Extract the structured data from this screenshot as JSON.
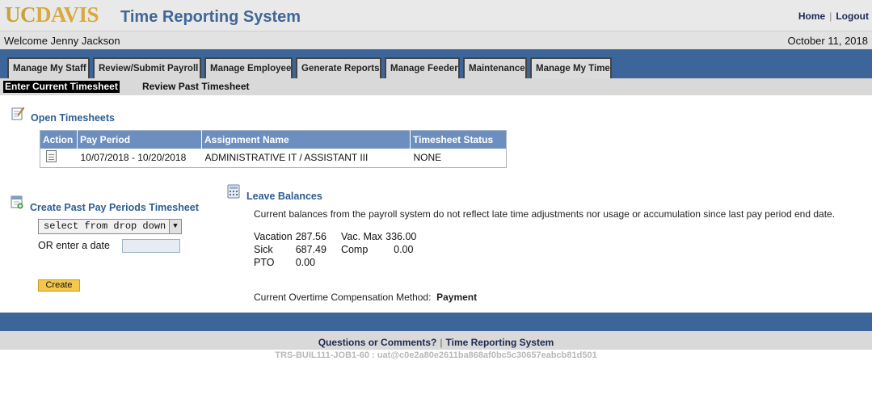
{
  "header": {
    "logo_uc": "UC",
    "logo_davis": "DAVIS",
    "title": "Time Reporting System",
    "home_label": "Home",
    "logout_label": "Logout",
    "separator": "|"
  },
  "welcome": {
    "text": "Welcome Jenny Jackson",
    "date": "October 11, 2018"
  },
  "tabs": [
    {
      "label": "Manage My Staff"
    },
    {
      "label": "Review/Submit Payroll"
    },
    {
      "label": "Manage Employee"
    },
    {
      "label": "Generate Reports"
    },
    {
      "label": "Manage Feeder"
    },
    {
      "label": "Maintenance"
    },
    {
      "label": "Manage My Time",
      "active": true
    }
  ],
  "subnav": {
    "active": "Enter Current Timesheet",
    "other": "Review Past Timesheet"
  },
  "open_timesheets": {
    "title": "Open Timesheets",
    "icon": "edit-note-icon",
    "columns": [
      "Action",
      "Pay Period",
      "Assignment Name",
      "Timesheet Status"
    ],
    "rows": [
      {
        "action_icon": "document-icon",
        "pay_period": "10/07/2018 - 10/20/2018",
        "assignment": "ADMINISTRATIVE IT / ASSISTANT III",
        "status": "NONE"
      }
    ]
  },
  "past_periods": {
    "title": "Create Past Pay Periods Timesheet",
    "icon": "calendar-add-icon",
    "select_value": "select from drop down",
    "date_label": "OR enter a date",
    "date_value": "",
    "create_label": "Create"
  },
  "leave_balances": {
    "title": "Leave Balances",
    "icon": "calculator-icon",
    "note": "Current balances from the payroll system do not reflect late time adjustments nor usage or accumulation since last pay period end date.",
    "vacation_label": "Vacation",
    "vacation_value": "287.56",
    "vac_max_label": "Vac. Max",
    "vac_max_value": "336.00",
    "sick_label": "Sick",
    "sick_value": "687.49",
    "comp_label": "Comp",
    "comp_value": "0.00",
    "pto_label": "PTO",
    "pto_value": "0.00",
    "ot_label": "Current Overtime Compensation Method:",
    "ot_value": "Payment"
  },
  "footer": {
    "questions": "Questions or Comments?",
    "separator": "|",
    "system": "Time Reporting System",
    "build": "TRS-BUIL111-JOB1-60 : uat@c0e2a80e2611ba868af0bc5c30657eabcb81d501"
  },
  "colors": {
    "brand_blue": "#3c6699",
    "header_gold": "#d8a93f",
    "table_header": "#6c8fc0",
    "button_gold": "#f5c84c"
  }
}
